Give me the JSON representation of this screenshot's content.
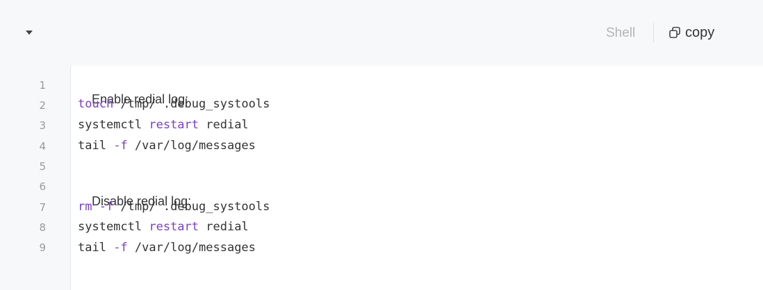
{
  "toolbar": {
    "language_label": "Shell",
    "copy_label": "copy",
    "collapse_icon": "caret-down-icon",
    "copy_icon": "copy-icon"
  },
  "colors": {
    "keyword": "#7a3fc4",
    "text": "#333333",
    "line_number": "#9a9a9a",
    "header_bg": "#f7f8fa"
  },
  "code": {
    "line_numbers": [
      "1",
      "2",
      "3",
      "4",
      "5",
      "6",
      "7",
      "8",
      "9"
    ],
    "lines": [
      {
        "kind": "comment",
        "text": "Enable redial log:"
      },
      {
        "kind": "code",
        "kw": "touch",
        "rest": " /tmp/ .debug_systools"
      },
      {
        "kind": "code",
        "pre": "systemctl ",
        "kw": "restart",
        "rest": " redial"
      },
      {
        "kind": "code",
        "pre": "tail ",
        "kw": "-f",
        "rest": " /var/log/messages"
      },
      {
        "kind": "blank",
        "text": ""
      },
      {
        "kind": "comment",
        "text": "Disable redial log:"
      },
      {
        "kind": "code",
        "kw": "rm -f",
        "rest": " /tmp/ .debug_systools"
      },
      {
        "kind": "code",
        "pre": "systemctl ",
        "kw": "restart",
        "rest": " redial"
      },
      {
        "kind": "code",
        "pre": "tail ",
        "kw": "-f",
        "rest": " /var/log/messages"
      }
    ]
  }
}
